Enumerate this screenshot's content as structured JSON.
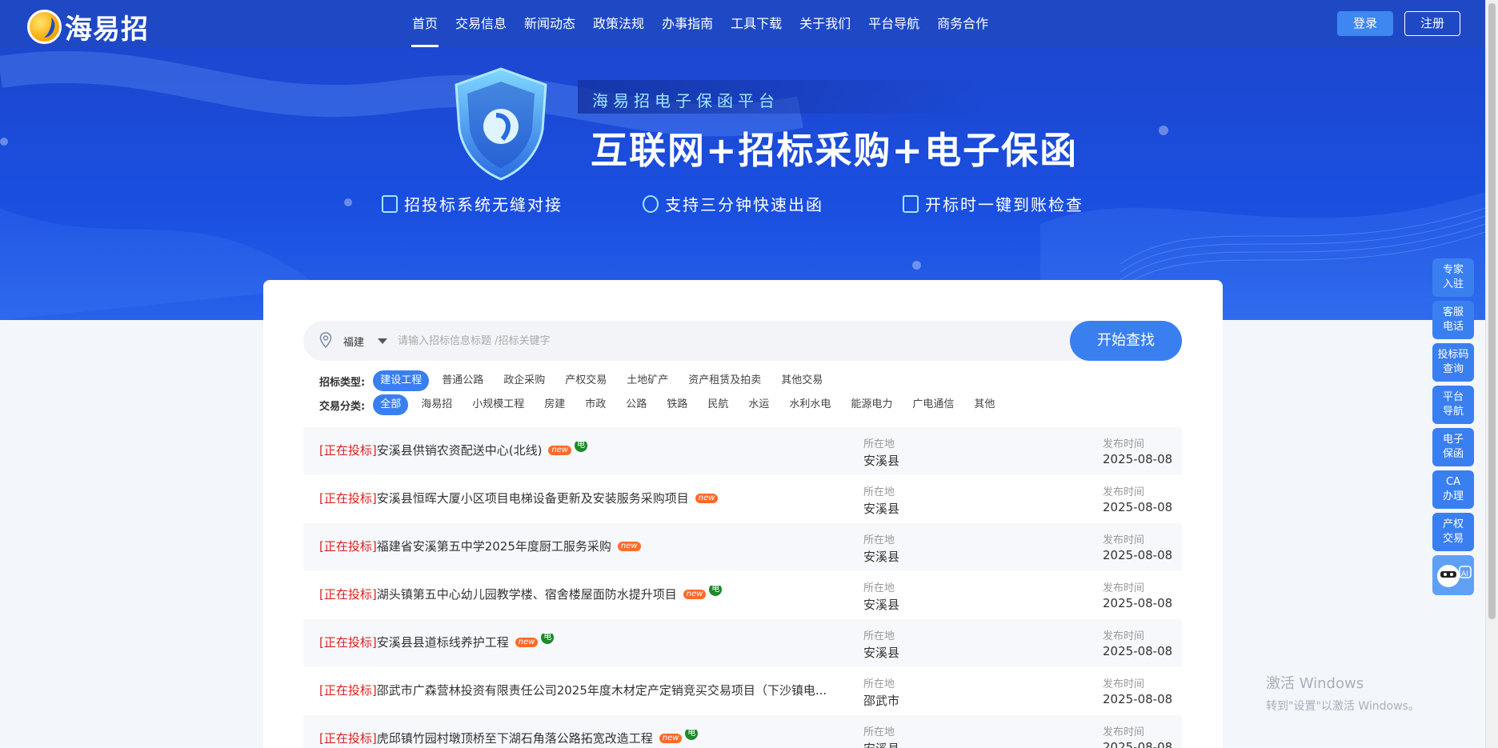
{
  "header": {
    "logo_text": "海易招",
    "nav": [
      {
        "label": "首页",
        "active": true
      },
      {
        "label": "交易信息"
      },
      {
        "label": "新闻动态"
      },
      {
        "label": "政策法规"
      },
      {
        "label": "办事指南"
      },
      {
        "label": "工具下载"
      },
      {
        "label": "关于我们"
      },
      {
        "label": "平台导航"
      },
      {
        "label": "商务合作"
      }
    ],
    "login": "登录",
    "register": "注册"
  },
  "banner": {
    "subtitle": "海易招电子保函平台",
    "title": "互联网+招标采购+电子保函",
    "features": [
      "招投标系统无缝对接",
      "支持三分钟快速出函",
      "开标时一键到账检查"
    ]
  },
  "search": {
    "region": "福建",
    "placeholder": "请输入招标信息标题 /招标关键字",
    "button": "开始查找"
  },
  "filters": {
    "type_label": "招标类型:",
    "types": [
      "建设工程",
      "普通公路",
      "政企采购",
      "产权交易",
      "土地矿产",
      "资产租赁及拍卖",
      "其他交易"
    ],
    "category_label": "交易分类:",
    "categories": [
      "全部",
      "海易招",
      "小规模工程",
      "房建",
      "市政",
      "公路",
      "铁路",
      "民航",
      "水运",
      "水利水电",
      "能源电力",
      "广电通信",
      "其他"
    ]
  },
  "list": {
    "loc_caption": "所在地",
    "date_caption": "发布时间",
    "badge_new": "new",
    "badge_e": "电",
    "rows": [
      {
        "status": "[正在投标]",
        "title": "安溪县供销农资配送中心(北线)",
        "new": true,
        "e": true,
        "location": "安溪县",
        "date": "2025-08-08"
      },
      {
        "status": "[正在投标]",
        "title": "安溪县恒晖大厦小区项目电梯设备更新及安装服务采购项目",
        "new": true,
        "e": false,
        "location": "安溪县",
        "date": "2025-08-08"
      },
      {
        "status": "[正在投标]",
        "title": "福建省安溪第五中学2025年度厨工服务采购",
        "new": true,
        "e": false,
        "location": "安溪县",
        "date": "2025-08-08"
      },
      {
        "status": "[正在投标]",
        "title": "湖头镇第五中心幼儿园教学楼、宿舍楼屋面防水提升项目",
        "new": true,
        "e": true,
        "location": "安溪县",
        "date": "2025-08-08"
      },
      {
        "status": "[正在投标]",
        "title": "安溪县县道标线养护工程",
        "new": true,
        "e": true,
        "location": "安溪县",
        "date": "2025-08-08"
      },
      {
        "status": "[正在投标]",
        "title": "邵武市广森营林投资有限责任公司2025年度木材定产定销竞买交易项目（下沙镇电...",
        "new": false,
        "e": false,
        "location": "邵武市",
        "date": "2025-08-08"
      },
      {
        "status": "[正在投标]",
        "title": "虎邱镇竹园村墩顶桥至下湖石角落公路拓宽改造工程",
        "new": true,
        "e": true,
        "location": "安溪县",
        "date": "2025-08-08"
      }
    ]
  },
  "tools": [
    "专家入驻",
    "客服电话",
    "投标码查询",
    "平台导航",
    "电子保函",
    "CA办理",
    "产权交易"
  ],
  "tools_lines": [
    [
      "专家",
      "入驻"
    ],
    [
      "客服",
      "电话"
    ],
    [
      "投标码",
      "查询"
    ],
    [
      "平台",
      "导航"
    ],
    [
      "电子",
      "保函"
    ],
    [
      "CA",
      "办理"
    ],
    [
      "产权",
      "交易"
    ]
  ],
  "ai_label": "AI",
  "watermark": {
    "line1": "激活 Windows",
    "line2": "转到\"设置\"以激活 Windows。"
  }
}
